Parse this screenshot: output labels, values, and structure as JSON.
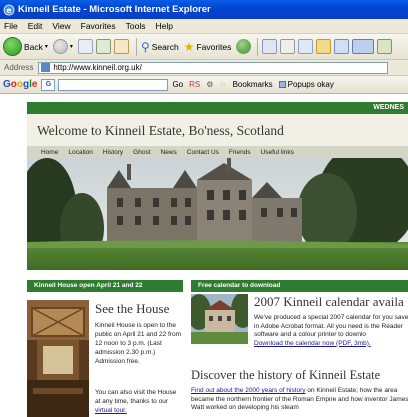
{
  "window": {
    "title": "Kinneil Estate - Microsoft Internet Explorer"
  },
  "menu": [
    "File",
    "Edit",
    "View",
    "Favorites",
    "Tools",
    "Help"
  ],
  "toolbar": {
    "back_label": "Back",
    "search_label": "Search",
    "favorites_label": "Favorites"
  },
  "address": {
    "label": "Address",
    "url": "http://www.kinneil.org.uk/"
  },
  "google_bar": {
    "logo": "Google",
    "go_label": "Go",
    "rs_label": "RS",
    "bookmarks_label": "Bookmarks",
    "popups_label": "Popups okay"
  },
  "site": {
    "topbar_text": "WEDNES",
    "title": "Welcome to Kinneil Estate, Bo'ness, Scotland",
    "nav": [
      "Home",
      "Location",
      "History",
      "Ghost",
      "News",
      "Contact Us",
      "Friends",
      "Useful links"
    ],
    "left_header": "Kinneil House open April 21 and 22",
    "right_header": "Free calendar to download",
    "see_title": "See the House",
    "see_text": "Kinneil House is open to the public on April 21 and 22 from 12 noon to 3 p.m. (Last admission 2.30 p.m.) Admission free.",
    "see_text2_a": "You can also visit the House at any time, thanks to our ",
    "see_text2_link": "virtual tour.",
    "calendar_title": "2007 Kinneil calendar availa",
    "calendar_text": "We've produced a special 2007 calendar for you saved in Adobe Acrobat format. All you need is the Reader software and a colour printer to downlo",
    "calendar_link": "Download the calendar now (PDF, 3mb).",
    "discover_title": "Discover the history of Kinneil Estate",
    "discover_link": "Find out about the 2000 years of history",
    "discover_text": " on Kinneil Estate; how the area became the northern frontier of the Roman Empire and how inventor James Watt worked on developing his steam"
  },
  "colors": {
    "site_green": "#2f7b2f",
    "xp_blue": "#0046d5"
  }
}
